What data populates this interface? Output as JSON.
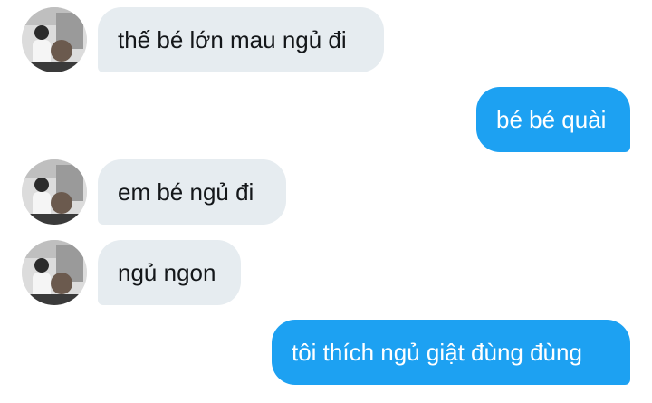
{
  "colors": {
    "incoming_bubble": "#e6ecf0",
    "outgoing_bubble": "#1da1f2",
    "incoming_text": "#14171a",
    "outgoing_text": "#ffffff"
  },
  "messages": [
    {
      "direction": "incoming",
      "text": "thế bé lớn mau ngủ đi",
      "avatar": "user-avatar"
    },
    {
      "direction": "outgoing",
      "text": "bé bé quài"
    },
    {
      "direction": "incoming",
      "text": "em bé ngủ đi",
      "avatar": "user-avatar"
    },
    {
      "direction": "incoming",
      "text": "ngủ ngon",
      "avatar": "user-avatar"
    },
    {
      "direction": "outgoing",
      "text": "tôi thích ngủ giật đùng đùng"
    }
  ]
}
